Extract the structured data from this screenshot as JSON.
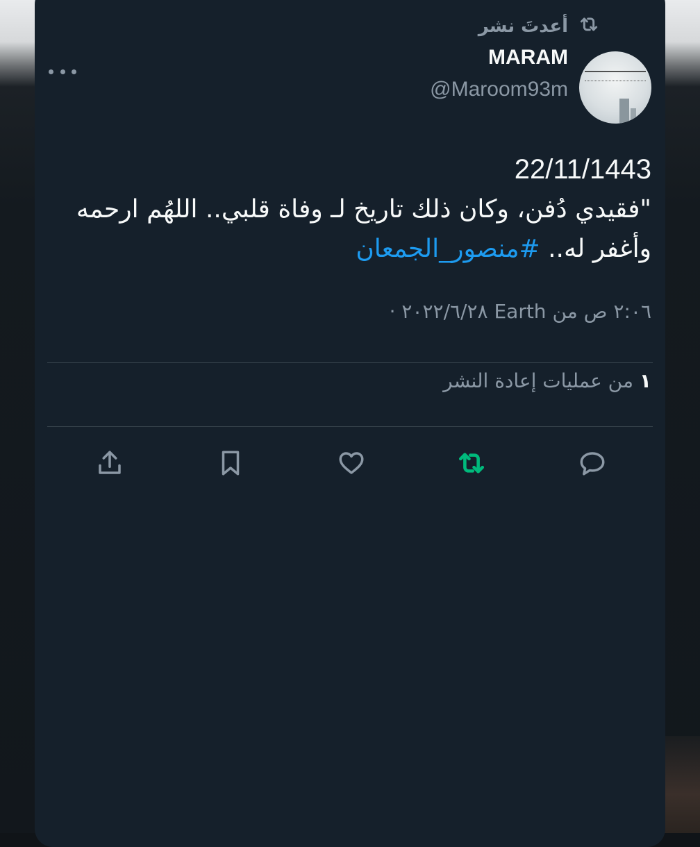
{
  "retweet_header": {
    "label": "أعدتَ نشر"
  },
  "author": {
    "display_name": "MARAM",
    "handle": "@Maroom93m"
  },
  "tweet": {
    "date_line": "22/11/1443",
    "text_line": "\"فقيدي دُفن، وكان ذلك تاريخ لـ وفاة قلبي.. اللهُم ارحمه وأغفر له.. ",
    "hashtag": "#منصور_الجمعان"
  },
  "meta": {
    "timestamp": "٢:٠٦ ص من Earth ٢٠٢٢/٦/٢٨ ·"
  },
  "stats": {
    "retweets_count": "١",
    "retweets_label": "من عمليات إعادة النشر"
  },
  "icons": {
    "retweet": "retweet-icon",
    "more": "more-icon",
    "reply": "reply-icon",
    "like": "heart-icon",
    "bookmark": "bookmark-icon",
    "share": "share-icon"
  },
  "colors": {
    "background": "#15202b",
    "accent": "#1d9bf0",
    "retweet_active": "#00ba7c",
    "muted": "#8b98a5"
  }
}
